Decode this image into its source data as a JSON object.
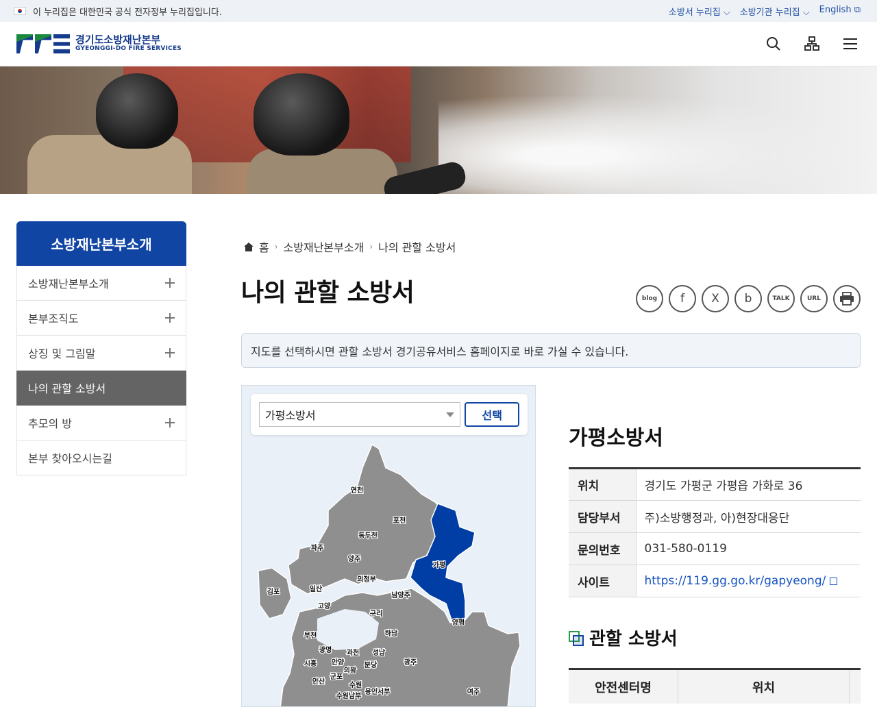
{
  "gov": {
    "notice": "이 누리집은 대한민국 공식 전자정부 누리집입니다.",
    "links": [
      "소방서 누리집",
      "소방기관 누리집",
      "English"
    ]
  },
  "header": {
    "logo_ko": "경기도소방재난본부",
    "logo_en": "GYEONGGI-DO FIRE SERVICES"
  },
  "lnb": {
    "title": "소방재난본부소개",
    "items": [
      {
        "label": "소방재난본부소개",
        "expandable": true
      },
      {
        "label": "본부조직도",
        "expandable": true
      },
      {
        "label": "상징 및 그림말",
        "expandable": true
      },
      {
        "label": "나의 관할 소방서",
        "expandable": false,
        "active": true
      },
      {
        "label": "추모의 방",
        "expandable": true
      },
      {
        "label": "본부 찾아오시는길",
        "expandable": false
      }
    ]
  },
  "breadcrumb": [
    "홈",
    "소방재난본부소개",
    "나의 관할 소방서"
  ],
  "page_title": "나의 관할 소방서",
  "share": [
    "blog",
    "f",
    "X",
    "b",
    "TALK",
    "URL",
    "print"
  ],
  "notice": "지도를 선택하시면 관할 소방서 경기공유서비스 홈페이지로 바로 가실 수 있습니다.",
  "map": {
    "selected": "가평소방서",
    "select_button": "선택",
    "labels": [
      "연천",
      "포천",
      "동두천",
      "파주",
      "양주",
      "가평",
      "의정부",
      "김포",
      "일산",
      "남양주",
      "고양",
      "구리",
      "양평",
      "부천",
      "하남",
      "광명",
      "과천",
      "성남",
      "시흥",
      "안양",
      "광주",
      "의왕",
      "분당",
      "안산",
      "군포",
      "수원",
      "용인서부",
      "수원남부",
      "여주"
    ],
    "highlight_color": "#003da5",
    "region_color": "#8f8f8f"
  },
  "station": {
    "name": "가평소방서",
    "rows": [
      {
        "key": "위치",
        "value": "경기도 가평군 가평읍 가화로 36"
      },
      {
        "key": "담당부서",
        "value": "주)소방행정과, 아)현장대응단"
      },
      {
        "key": "문의번호",
        "value": "031-580-0119"
      },
      {
        "key": "사이트",
        "value": "https://119.gg.go.kr/gapyeong/"
      }
    ]
  },
  "sub_section": {
    "title": "관할 소방서",
    "columns": [
      "안전센터명",
      "위치"
    ]
  }
}
